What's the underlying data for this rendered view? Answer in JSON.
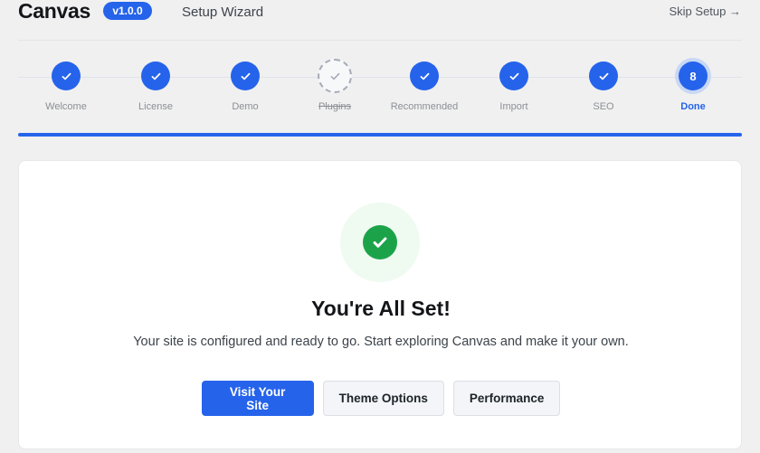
{
  "header": {
    "brand": "Canvas",
    "version": "v1.0.0",
    "wizard_title": "Setup Wizard",
    "skip_label": "Skip Setup →"
  },
  "steps": [
    {
      "label": "Welcome",
      "state": "completed"
    },
    {
      "label": "License",
      "state": "completed"
    },
    {
      "label": "Demo",
      "state": "completed"
    },
    {
      "label": "Plugins",
      "state": "skipped"
    },
    {
      "label": "Recommended",
      "state": "completed"
    },
    {
      "label": "Import",
      "state": "completed"
    },
    {
      "label": "SEO",
      "state": "completed"
    },
    {
      "label": "Done",
      "state": "current",
      "number": "8"
    }
  ],
  "progress": 1.0,
  "completion": {
    "title": "You're All Set!",
    "subtitle": "Your site is configured and ready to go. Start exploring Canvas and make it your own.",
    "buttons": {
      "visit": "Visit Your Site",
      "theme": "Theme Options",
      "performance": "Performance"
    }
  },
  "colors": {
    "accent": "#2563eb",
    "success": "#1ca34a",
    "success_bg": "#effaf1",
    "muted": "#8c8f94",
    "page_bg": "#f0f0f1"
  }
}
